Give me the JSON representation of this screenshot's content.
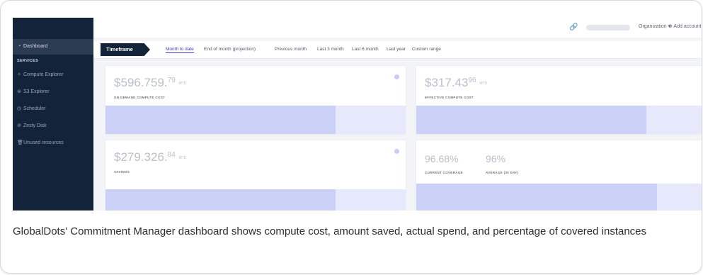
{
  "sidebar": {
    "items": [
      {
        "label": "Dashboard",
        "icon": "dashboard-icon",
        "glyph": "◔"
      },
      {
        "label": "Compute Explorer",
        "icon": "compute-icon",
        "glyph": "✧"
      },
      {
        "label": "S3 Explorer",
        "icon": "storage-icon",
        "glyph": "⊜"
      },
      {
        "label": "Scheduler",
        "icon": "clock-icon",
        "glyph": "◷"
      },
      {
        "label": "Zesty Disk",
        "icon": "disk-icon",
        "glyph": "⊘"
      },
      {
        "label": "Unused resources",
        "icon": "trash-icon",
        "glyph": "🗑"
      }
    ],
    "section": "SERVICES"
  },
  "topbar": {
    "org_label": "Organization ▾",
    "add_account": "⊕ Add account"
  },
  "timeframe": {
    "label": "Timeframe",
    "options": [
      "Month to date",
      "End of month (projection)",
      "Previous month",
      "Last 3 month",
      "Last 6 month",
      "Last year",
      "Custom range"
    ],
    "selected": "Month to date"
  },
  "panels": {
    "on_demand": {
      "main": "$596.759.",
      "sup": "79",
      "unit": "MTD",
      "label": "ON-DEMAND COMPUTE COST"
    },
    "effective": {
      "main": "$317.43",
      "sup": "96",
      "unit": "MTD",
      "label": "EFFECTIVE COMPUTE COST"
    },
    "savings": {
      "main": "$279.326.",
      "sup": "84",
      "unit": "MTD",
      "label": "SAVINGS"
    },
    "coverage": {
      "current": "96.68%",
      "current_label": "CURRENT COVERAGE",
      "average": "96%",
      "average_label": "AVERAGE (30 DAY)"
    }
  },
  "caption": "GlobalDots' Commitment Manager dashboard shows compute cost, amount saved, actual spend, and percentage of covered instances",
  "colors": {
    "sidebar": "#13233a",
    "accent": "#3d44c8",
    "chart": "#ccd1f7"
  }
}
